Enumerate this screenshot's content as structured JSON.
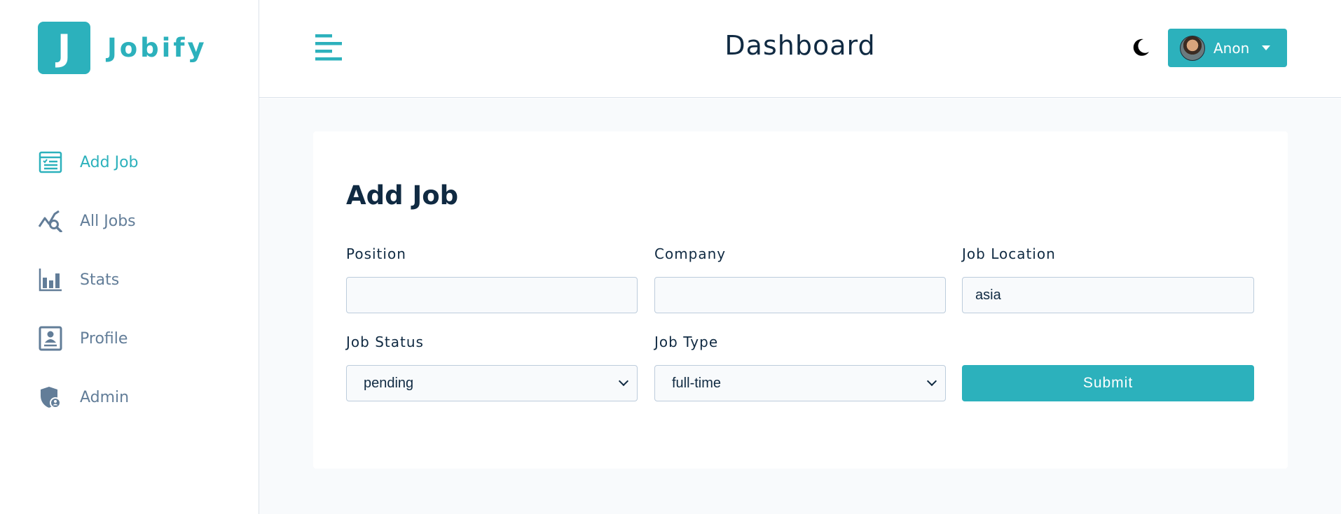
{
  "brand": {
    "logo_letter": "J",
    "name": "Jobify",
    "color": "#2cb1bc"
  },
  "sidebar": {
    "items": [
      {
        "label": "Add Job",
        "icon": "add-job-icon",
        "active": true
      },
      {
        "label": "All Jobs",
        "icon": "all-jobs-icon",
        "active": false
      },
      {
        "label": "Stats",
        "icon": "stats-icon",
        "active": false
      },
      {
        "label": "Profile",
        "icon": "profile-icon",
        "active": false
      },
      {
        "label": "Admin",
        "icon": "admin-icon",
        "active": false
      }
    ]
  },
  "header": {
    "title": "Dashboard",
    "toggle_icon": "menu-toggle-icon",
    "theme_icon": "moon-icon",
    "user": {
      "name": "Anon",
      "avatar_icon": "avatar"
    }
  },
  "form": {
    "title": "Add Job",
    "fields": {
      "position": {
        "label": "Position",
        "value": ""
      },
      "company": {
        "label": "Company",
        "value": ""
      },
      "location": {
        "label": "Job Location",
        "value": "asia"
      },
      "status": {
        "label": "Job Status",
        "value": "pending"
      },
      "type": {
        "label": "Job Type",
        "value": "full-time"
      }
    },
    "submit_label": "Submit"
  },
  "colors": {
    "primary": "#2cb1bc",
    "text": "#102a42",
    "muted": "#627d98",
    "background": "#f8fafc"
  }
}
